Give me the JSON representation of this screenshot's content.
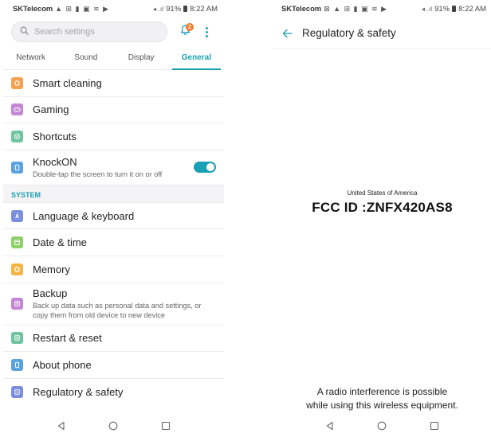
{
  "left": {
    "statusbar": {
      "carrier": "SKTelecom",
      "status_icons": "▲ ⊞ ▮ ▣ ≋ ▶",
      "signal": "◂ .ıl",
      "battery": "91%",
      "time": "8:22 AM"
    },
    "search": {
      "placeholder": "Search settings",
      "badge_count": "2"
    },
    "tabs": [
      {
        "label": "Network",
        "active": false
      },
      {
        "label": "Sound",
        "active": false
      },
      {
        "label": "Display",
        "active": false
      },
      {
        "label": "General",
        "active": true
      }
    ],
    "items_top": [
      {
        "title": "Smart cleaning",
        "icon": "smart-cleaning-icon",
        "color": "#f6a04d"
      },
      {
        "title": "Gaming",
        "icon": "gamepad-icon",
        "color": "#c586d6"
      },
      {
        "title": "Shortcuts",
        "icon": "shortcuts-icon",
        "color": "#6fc5a0"
      }
    ],
    "knockon": {
      "title": "KnockON",
      "subtitle": "Double-tap the screen to turn it on or off",
      "enabled": true,
      "icon": "knock-icon",
      "color": "#5aa2de"
    },
    "section": "SYSTEM",
    "items_system": [
      {
        "title": "Language & keyboard",
        "icon": "language-icon",
        "color": "#7a8fe0"
      },
      {
        "title": "Date & time",
        "icon": "calendar-icon",
        "color": "#8ed06a"
      },
      {
        "title": "Memory",
        "icon": "memory-icon",
        "color": "#f6b443"
      }
    ],
    "backup": {
      "title": "Backup",
      "subtitle": "Back up data such as personal data and settings, or copy them from old device to new device",
      "icon": "backup-icon",
      "color": "#c586d6"
    },
    "items_bottom": [
      {
        "title": "Restart & reset",
        "icon": "reset-icon",
        "color": "#6fc5a0"
      },
      {
        "title": "About phone",
        "icon": "info-icon",
        "color": "#5aa2de"
      },
      {
        "title": "Regulatory & safety",
        "icon": "regulatory-icon",
        "color": "#7a8fe0"
      }
    ]
  },
  "right": {
    "statusbar": {
      "carrier": "SKTelecom",
      "status_icons": "⊠ ▲ ⊞ ▮ ▣ ≋ ▶",
      "signal": "◂ .ıl",
      "battery": "91%",
      "time": "8:22 AM"
    },
    "title": "Regulatory & safety",
    "country": "United States of America",
    "fcc_id": "FCC ID :ZNFX420AS8",
    "note_line1": "A radio interference is possible",
    "note_line2": "while using this wireless equipment."
  },
  "accent_color": "#1aa0b6"
}
